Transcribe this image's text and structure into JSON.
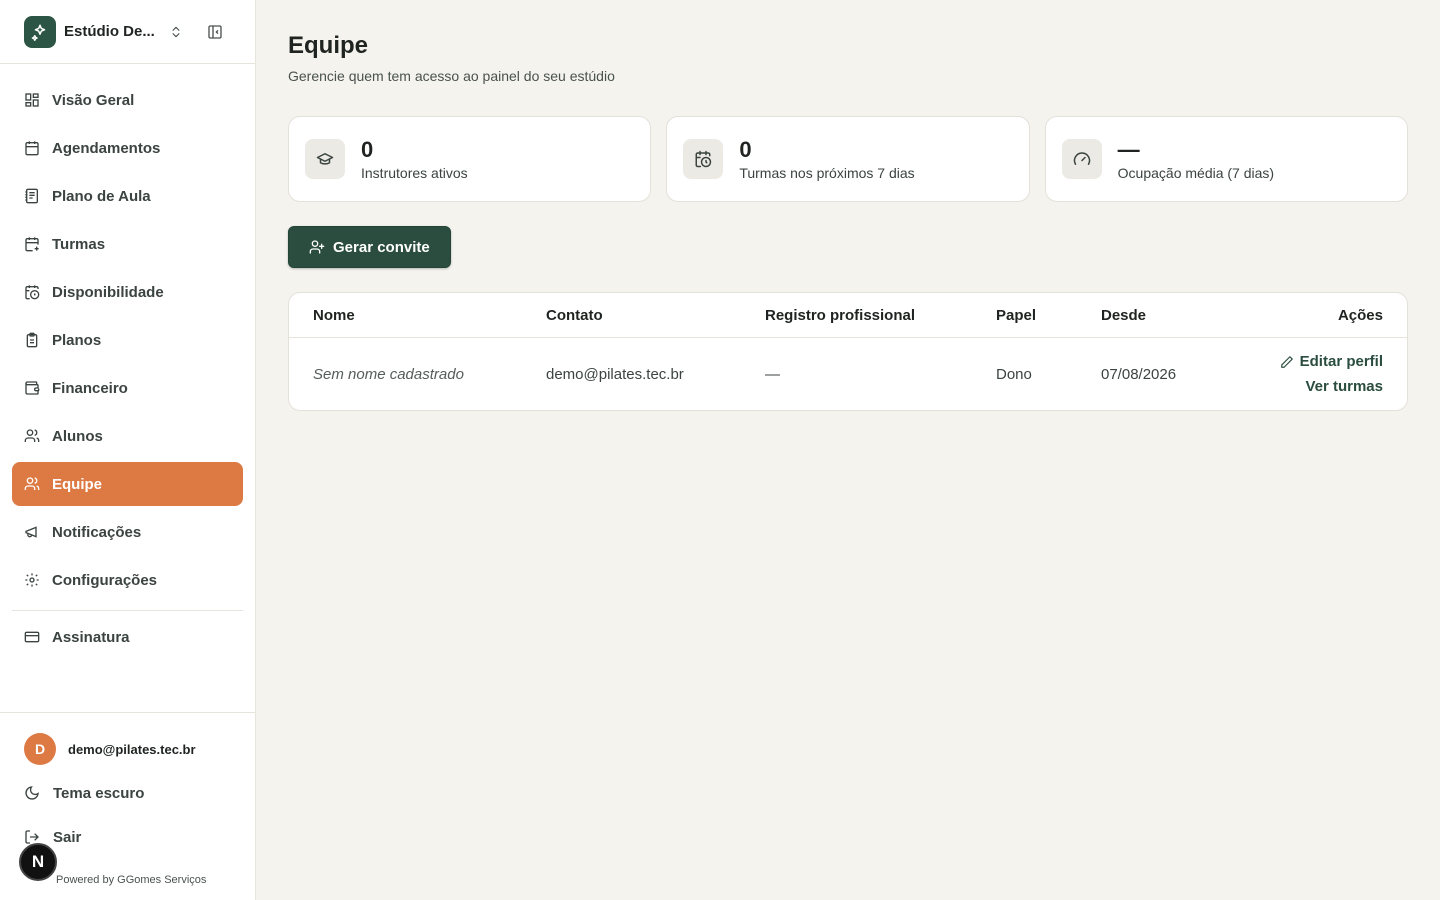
{
  "sidebar": {
    "studio_name": "Estúdio De...",
    "items": [
      {
        "label": "Visão Geral",
        "icon": "dashboard-icon"
      },
      {
        "label": "Agendamentos",
        "icon": "calendar-icon"
      },
      {
        "label": "Plano de Aula",
        "icon": "notebook-icon"
      },
      {
        "label": "Turmas",
        "icon": "calendar-plus-icon"
      },
      {
        "label": "Disponibilidade",
        "icon": "calendar-clock-icon"
      },
      {
        "label": "Planos",
        "icon": "clipboard-icon"
      },
      {
        "label": "Financeiro",
        "icon": "wallet-icon"
      },
      {
        "label": "Alunos",
        "icon": "users-icon"
      },
      {
        "label": "Equipe",
        "icon": "team-icon"
      },
      {
        "label": "Notificações",
        "icon": "megaphone-icon"
      },
      {
        "label": "Configurações",
        "icon": "gear-icon"
      }
    ],
    "subscription_label": "Assinatura",
    "active_color": "#dd7a43"
  },
  "user": {
    "avatar_initial": "D",
    "email": "demo@pilates.tec.br",
    "theme_label": "Tema escuro",
    "logout_label": "Sair",
    "powered_by": "Powered by GGomes Serviços",
    "next_badge": "N"
  },
  "page": {
    "title": "Equipe",
    "subtitle": "Gerencie quem tem acesso ao painel do seu estúdio"
  },
  "stats": [
    {
      "value": "0",
      "label": "Instrutores ativos",
      "icon": "graduation-cap-icon"
    },
    {
      "value": "0",
      "label": "Turmas nos próximos 7 dias",
      "icon": "calendar-clock-icon"
    },
    {
      "value": "—",
      "label": "Ocupação média (7 dias)",
      "icon": "gauge-icon"
    }
  ],
  "invite_button": "Gerar convite",
  "table": {
    "headers": [
      "Nome",
      "Contato",
      "Registro profissional",
      "Papel",
      "Desde",
      "Ações"
    ],
    "rows": [
      {
        "nome": "Sem nome cadastrado",
        "contato": "demo@pilates.tec.br",
        "registro": "—",
        "papel": "Dono",
        "desde": "07/08/2026",
        "edit_label": "Editar perfil",
        "classes_label": "Ver turmas"
      }
    ]
  },
  "colors": {
    "primary": "#2a4d3f",
    "accent": "#dd7a43",
    "background": "#f4f3ee"
  }
}
